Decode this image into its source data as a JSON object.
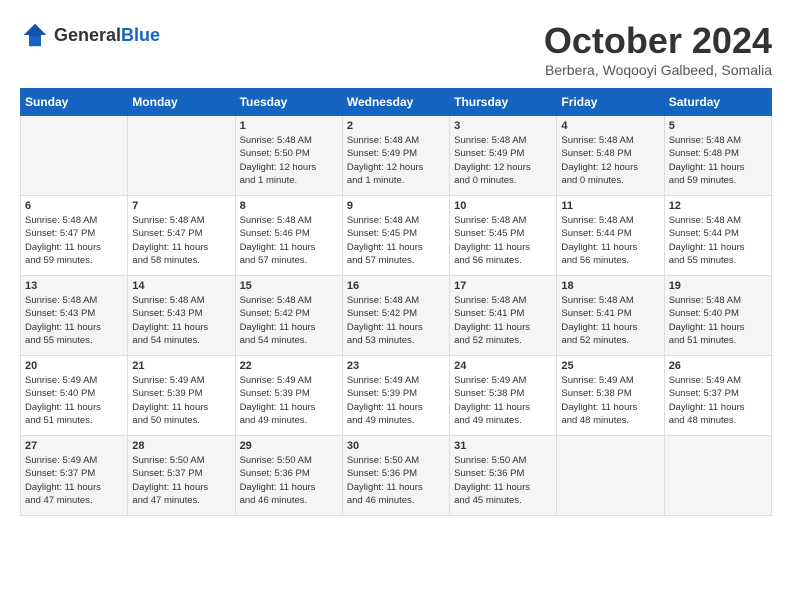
{
  "header": {
    "logo_general": "General",
    "logo_blue": "Blue",
    "month": "October 2024",
    "location": "Berbera, Woqooyi Galbeed, Somalia"
  },
  "days_of_week": [
    "Sunday",
    "Monday",
    "Tuesday",
    "Wednesday",
    "Thursday",
    "Friday",
    "Saturday"
  ],
  "weeks": [
    [
      {
        "day": "",
        "info": ""
      },
      {
        "day": "",
        "info": ""
      },
      {
        "day": "1",
        "info": "Sunrise: 5:48 AM\nSunset: 5:50 PM\nDaylight: 12 hours\nand 1 minute."
      },
      {
        "day": "2",
        "info": "Sunrise: 5:48 AM\nSunset: 5:49 PM\nDaylight: 12 hours\nand 1 minute."
      },
      {
        "day": "3",
        "info": "Sunrise: 5:48 AM\nSunset: 5:49 PM\nDaylight: 12 hours\nand 0 minutes."
      },
      {
        "day": "4",
        "info": "Sunrise: 5:48 AM\nSunset: 5:48 PM\nDaylight: 12 hours\nand 0 minutes."
      },
      {
        "day": "5",
        "info": "Sunrise: 5:48 AM\nSunset: 5:48 PM\nDaylight: 11 hours\nand 59 minutes."
      }
    ],
    [
      {
        "day": "6",
        "info": "Sunrise: 5:48 AM\nSunset: 5:47 PM\nDaylight: 11 hours\nand 59 minutes."
      },
      {
        "day": "7",
        "info": "Sunrise: 5:48 AM\nSunset: 5:47 PM\nDaylight: 11 hours\nand 58 minutes."
      },
      {
        "day": "8",
        "info": "Sunrise: 5:48 AM\nSunset: 5:46 PM\nDaylight: 11 hours\nand 57 minutes."
      },
      {
        "day": "9",
        "info": "Sunrise: 5:48 AM\nSunset: 5:45 PM\nDaylight: 11 hours\nand 57 minutes."
      },
      {
        "day": "10",
        "info": "Sunrise: 5:48 AM\nSunset: 5:45 PM\nDaylight: 11 hours\nand 56 minutes."
      },
      {
        "day": "11",
        "info": "Sunrise: 5:48 AM\nSunset: 5:44 PM\nDaylight: 11 hours\nand 56 minutes."
      },
      {
        "day": "12",
        "info": "Sunrise: 5:48 AM\nSunset: 5:44 PM\nDaylight: 11 hours\nand 55 minutes."
      }
    ],
    [
      {
        "day": "13",
        "info": "Sunrise: 5:48 AM\nSunset: 5:43 PM\nDaylight: 11 hours\nand 55 minutes."
      },
      {
        "day": "14",
        "info": "Sunrise: 5:48 AM\nSunset: 5:43 PM\nDaylight: 11 hours\nand 54 minutes."
      },
      {
        "day": "15",
        "info": "Sunrise: 5:48 AM\nSunset: 5:42 PM\nDaylight: 11 hours\nand 54 minutes."
      },
      {
        "day": "16",
        "info": "Sunrise: 5:48 AM\nSunset: 5:42 PM\nDaylight: 11 hours\nand 53 minutes."
      },
      {
        "day": "17",
        "info": "Sunrise: 5:48 AM\nSunset: 5:41 PM\nDaylight: 11 hours\nand 52 minutes."
      },
      {
        "day": "18",
        "info": "Sunrise: 5:48 AM\nSunset: 5:41 PM\nDaylight: 11 hours\nand 52 minutes."
      },
      {
        "day": "19",
        "info": "Sunrise: 5:48 AM\nSunset: 5:40 PM\nDaylight: 11 hours\nand 51 minutes."
      }
    ],
    [
      {
        "day": "20",
        "info": "Sunrise: 5:49 AM\nSunset: 5:40 PM\nDaylight: 11 hours\nand 51 minutes."
      },
      {
        "day": "21",
        "info": "Sunrise: 5:49 AM\nSunset: 5:39 PM\nDaylight: 11 hours\nand 50 minutes."
      },
      {
        "day": "22",
        "info": "Sunrise: 5:49 AM\nSunset: 5:39 PM\nDaylight: 11 hours\nand 49 minutes."
      },
      {
        "day": "23",
        "info": "Sunrise: 5:49 AM\nSunset: 5:39 PM\nDaylight: 11 hours\nand 49 minutes."
      },
      {
        "day": "24",
        "info": "Sunrise: 5:49 AM\nSunset: 5:38 PM\nDaylight: 11 hours\nand 49 minutes."
      },
      {
        "day": "25",
        "info": "Sunrise: 5:49 AM\nSunset: 5:38 PM\nDaylight: 11 hours\nand 48 minutes."
      },
      {
        "day": "26",
        "info": "Sunrise: 5:49 AM\nSunset: 5:37 PM\nDaylight: 11 hours\nand 48 minutes."
      }
    ],
    [
      {
        "day": "27",
        "info": "Sunrise: 5:49 AM\nSunset: 5:37 PM\nDaylight: 11 hours\nand 47 minutes."
      },
      {
        "day": "28",
        "info": "Sunrise: 5:50 AM\nSunset: 5:37 PM\nDaylight: 11 hours\nand 47 minutes."
      },
      {
        "day": "29",
        "info": "Sunrise: 5:50 AM\nSunset: 5:36 PM\nDaylight: 11 hours\nand 46 minutes."
      },
      {
        "day": "30",
        "info": "Sunrise: 5:50 AM\nSunset: 5:36 PM\nDaylight: 11 hours\nand 46 minutes."
      },
      {
        "day": "31",
        "info": "Sunrise: 5:50 AM\nSunset: 5:36 PM\nDaylight: 11 hours\nand 45 minutes."
      },
      {
        "day": "",
        "info": ""
      },
      {
        "day": "",
        "info": ""
      }
    ]
  ]
}
